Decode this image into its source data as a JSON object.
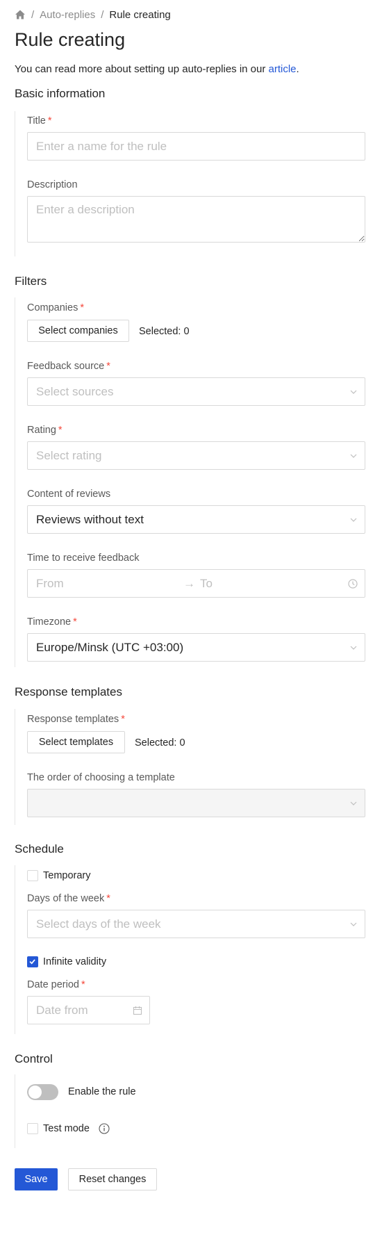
{
  "breadcrumb": {
    "items": [
      "Auto-replies",
      "Rule creating"
    ]
  },
  "page": {
    "title": "Rule creating",
    "intro_prefix": "You can read more about setting up auto-replies in our ",
    "intro_link": "article",
    "intro_suffix": "."
  },
  "basic": {
    "section_title": "Basic information",
    "title_label": "Title",
    "title_placeholder": "Enter a name for the rule",
    "title_value": "",
    "description_label": "Description",
    "description_placeholder": "Enter a description",
    "description_value": ""
  },
  "filters": {
    "section_title": "Filters",
    "companies_label": "Companies",
    "companies_button": "Select companies",
    "companies_selected": "Selected: 0",
    "source_label": "Feedback source",
    "source_placeholder": "Select sources",
    "rating_label": "Rating",
    "rating_placeholder": "Select rating",
    "content_label": "Content of reviews",
    "content_value": "Reviews without text",
    "time_label": "Time to receive feedback",
    "time_from_placeholder": "From",
    "time_arrow": "→",
    "time_to_placeholder": "To",
    "timezone_label": "Timezone",
    "timezone_value": "Europe/Minsk (UTC +03:00)"
  },
  "templates": {
    "section_title": "Response templates",
    "templates_label": "Response templates",
    "templates_button": "Select templates",
    "templates_selected": "Selected: 0",
    "order_label": "The order of choosing a template",
    "order_value": ""
  },
  "schedule": {
    "section_title": "Schedule",
    "temporary_label": "Temporary",
    "temporary_checked": false,
    "days_label": "Days of the week",
    "days_placeholder": "Select days of the week",
    "infinite_label": "Infinite validity",
    "infinite_checked": true,
    "period_label": "Date period",
    "date_from_placeholder": "Date from"
  },
  "control": {
    "section_title": "Control",
    "enable_label": "Enable the rule",
    "enable_on": false,
    "test_label": "Test mode",
    "test_checked": false
  },
  "actions": {
    "save_label": "Save",
    "reset_label": "Reset changes"
  },
  "colors": {
    "primary": "#2458d6",
    "required": "#f5483b",
    "border": "#d9d9d9",
    "placeholder": "#bfbfbf"
  },
  "icons": [
    "home-icon",
    "chevron-down-icon",
    "clock-icon",
    "calendar-icon",
    "check-icon",
    "info-icon"
  ]
}
